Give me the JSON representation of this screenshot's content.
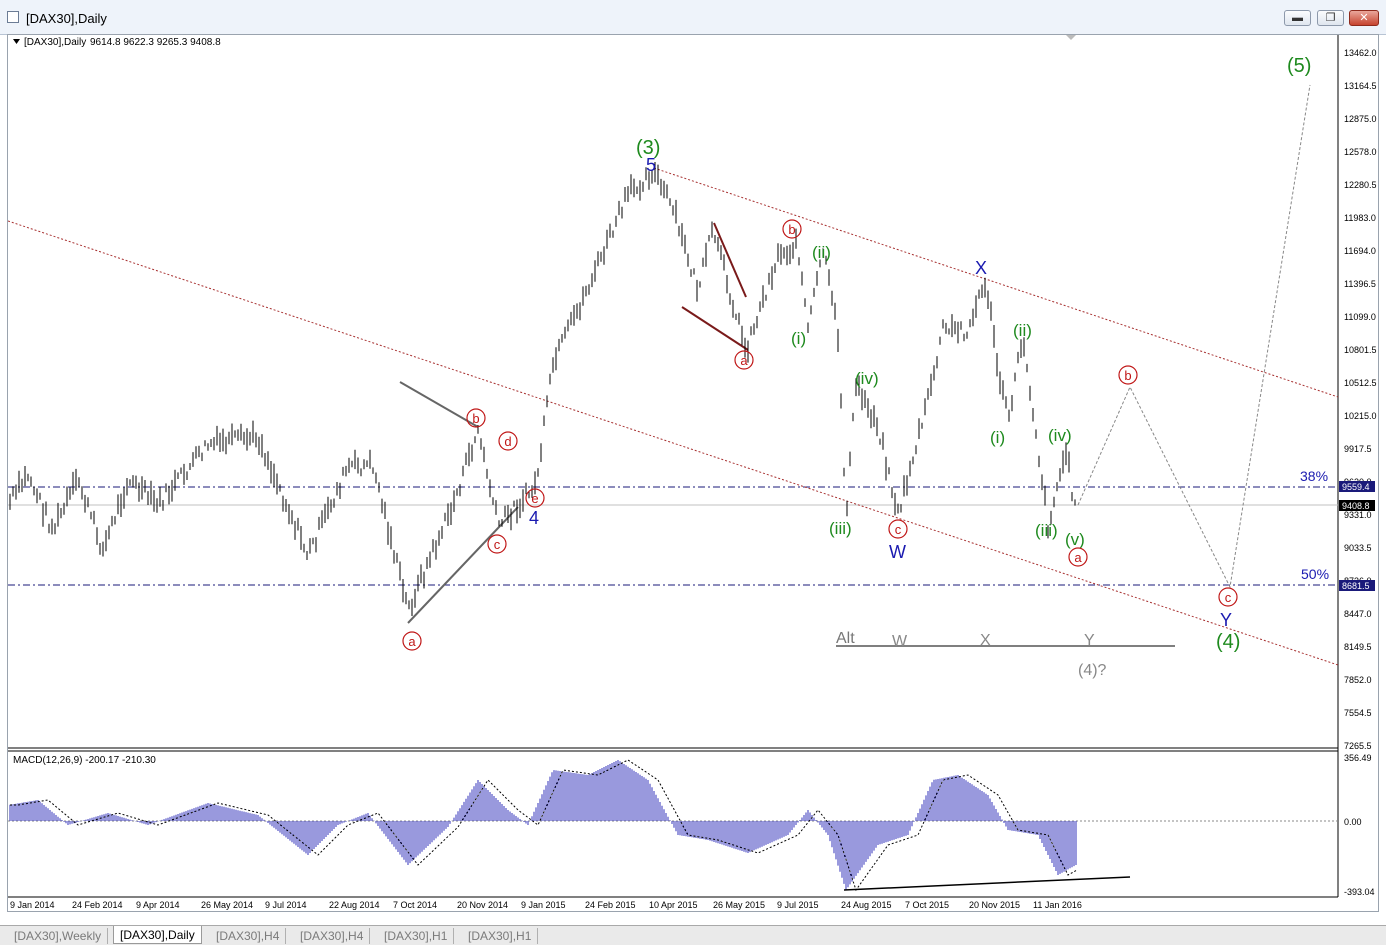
{
  "window": {
    "title": "[DAX30],Daily",
    "minimize_label": "▬",
    "restore_label": "❐",
    "close_label": "✕"
  },
  "header": {
    "symbol_info": "[DAX30],Daily",
    "ohlc": "9614.8 9622.3 9265.3 9408.8"
  },
  "macd": {
    "label": "MACD(12,26,9) -200.17 -210.30",
    "y_ticks": [
      "356.49",
      "0.00",
      "-393.04"
    ]
  },
  "price_axis": {
    "ticks": [
      "13462.0",
      "13164.5",
      "12875.0",
      "12578.0",
      "12280.5",
      "11983.0",
      "11694.0",
      "11396.5",
      "11099.0",
      "10801.5",
      "10512.5",
      "10215.0",
      "9917.5",
      "9620.0",
      "9331.0",
      "9033.5",
      "8736.0",
      "8447.0",
      "8149.5",
      "7852.0",
      "7554.5",
      "7265.5"
    ],
    "current_price": "9408.8",
    "fib38_price": "9559.4",
    "fib50_price": "8681.5"
  },
  "time_axis": [
    "9 Jan 2014",
    "24 Feb 2014",
    "9 Apr 2014",
    "26 May 2014",
    "9 Jul 2014",
    "22 Aug 2014",
    "7 Oct 2014",
    "20 Nov 2014",
    "9 Jan 2015",
    "24 Feb 2015",
    "10 Apr 2015",
    "26 May 2015",
    "9 Jul 2015",
    "24 Aug 2015",
    "7 Oct 2015",
    "20 Nov 2015",
    "11 Jan 2016"
  ],
  "fib_levels": {
    "level_38": "38%",
    "level_50": "50%"
  },
  "wave_labels": {
    "w3": "(3)",
    "w5": "(5)",
    "w4": "(4)",
    "w4q": "(4)?",
    "five": "5",
    "four": "4",
    "X": "X",
    "W": "W",
    "Y": "Y",
    "i": "(i)",
    "ii": "(ii)",
    "iii": "(iii)",
    "iv": "(iv)",
    "v": "(v)",
    "a": "a",
    "b": "b",
    "c": "c",
    "d": "d",
    "e": "e",
    "alt": "Alt",
    "alt_w": "W",
    "alt_x": "X",
    "alt_y": "Y"
  },
  "tabs": [
    "[DAX30],Weekly",
    "[DAX30],Daily",
    "[DAX30],H4",
    "[DAX30],H4",
    "[DAX30],H1",
    "[DAX30],H1"
  ],
  "active_tab": 1,
  "colors": {
    "bars": "#000000",
    "macd": "#3333bb",
    "wave_green": "#1e8a1e",
    "wave_blue": "#1a1ab0",
    "wave_red": "#c01818",
    "channel": "#a83232",
    "fib": "#1a1a7a"
  }
}
